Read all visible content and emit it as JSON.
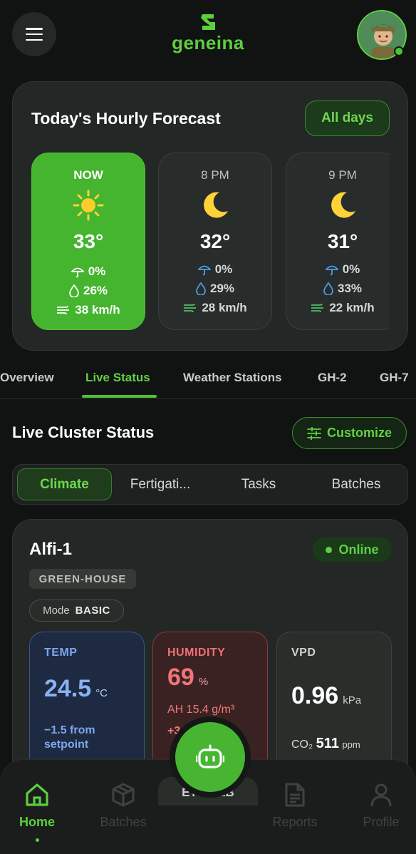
{
  "header": {
    "logo_text": "geneina",
    "menu_icon": "hamburger-icon",
    "avatar_icon": "user-avatar"
  },
  "forecast": {
    "title": "Today's Hourly Forecast",
    "all_days_label": "All days",
    "hours": [
      {
        "label": "NOW",
        "icon": "sun-icon",
        "temp": "33°",
        "rain": "0%",
        "humidity": "26%",
        "wind": "38 km/h"
      },
      {
        "label": "8 PM",
        "icon": "moon-icon",
        "temp": "32°",
        "rain": "0%",
        "humidity": "29%",
        "wind": "28 km/h"
      },
      {
        "label": "9 PM",
        "icon": "moon-icon",
        "temp": "31°",
        "rain": "0%",
        "humidity": "33%",
        "wind": "22 km/h"
      }
    ]
  },
  "tabs": [
    "Overview",
    "Live Status",
    "Weather Stations",
    "GH-2",
    "GH-7"
  ],
  "active_tab": "Live Status",
  "live_cluster": {
    "title": "Live Cluster Status",
    "customize_label": "Customize",
    "segments": [
      "Climate",
      "Fertigati...",
      "Tasks",
      "Batches"
    ],
    "active_segment": "Climate"
  },
  "cluster": {
    "name": "Alfi-1",
    "status": "Online",
    "type_badge": "GREEN-HOUSE",
    "mode_key": "Mode",
    "mode_value": "BASIC",
    "temp": {
      "label": "TEMP",
      "value": "24.5",
      "unit": "°C",
      "sub": "−1.5 from setpoint"
    },
    "humidity": {
      "label": "HUMIDITY",
      "value": "69",
      "unit": "%",
      "ah": "AH 15.4 g/m³",
      "sub": "+3 se"
    },
    "vpd": {
      "label": "VPD",
      "value": "0.96",
      "unit": "kPa",
      "co2_label": "CO₂",
      "co2_value": "511",
      "co2_unit": "ppm"
    },
    "wet_bulb_label": "ET BULB"
  },
  "bottom_nav": {
    "items": [
      "Home",
      "Batches",
      "Reports",
      "Profile"
    ],
    "active": "Home"
  },
  "colors": {
    "accent_green": "#5ccf3f",
    "temp_blue": "#8ab1f5",
    "humidity_red": "#f07575"
  }
}
